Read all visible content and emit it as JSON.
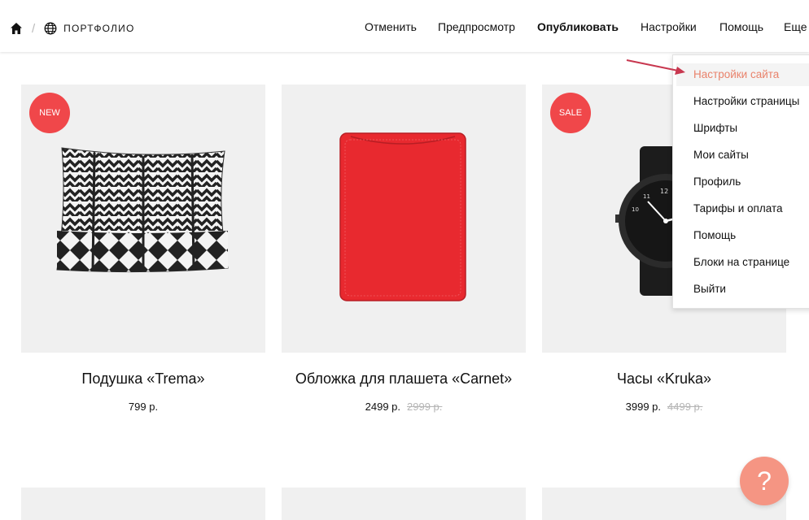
{
  "breadcrumb": {
    "project": "ПОРТФОЛИО",
    "home_icon": "home-icon",
    "globe_icon": "globe-icon"
  },
  "topbar": {
    "undo": "Отменить",
    "preview": "Предпросмотр",
    "publish": "Опубликовать",
    "settings": "Настройки",
    "help": "Помощь",
    "more": "Еще"
  },
  "dropdown": {
    "items": [
      {
        "label": "Настройки сайта"
      },
      {
        "label": "Настройки страницы"
      },
      {
        "label": "Шрифты"
      },
      {
        "label": "Мои сайты"
      },
      {
        "label": "Профиль"
      },
      {
        "label": "Тарифы и оплата"
      },
      {
        "label": "Помощь"
      },
      {
        "label": "Блоки на странице"
      },
      {
        "label": "Выйти"
      }
    ],
    "active_color": "#e9826b"
  },
  "products": [
    {
      "title": "Подушка «Trema»",
      "price": "799 р.",
      "old_price": "",
      "badge": "NEW"
    },
    {
      "title": "Обложка для плашета «Carnet»",
      "price": "2499 р.",
      "old_price": "2999 р.",
      "badge": ""
    },
    {
      "title": "Часы «Kruka»",
      "price": "3999 р.",
      "old_price": "4499 р.",
      "badge": "SALE"
    }
  ],
  "help_fab": {
    "label": "?"
  },
  "colors": {
    "badge": "#f0474a",
    "fab": "#f59583",
    "annotation_arrow": "#c8374f"
  }
}
